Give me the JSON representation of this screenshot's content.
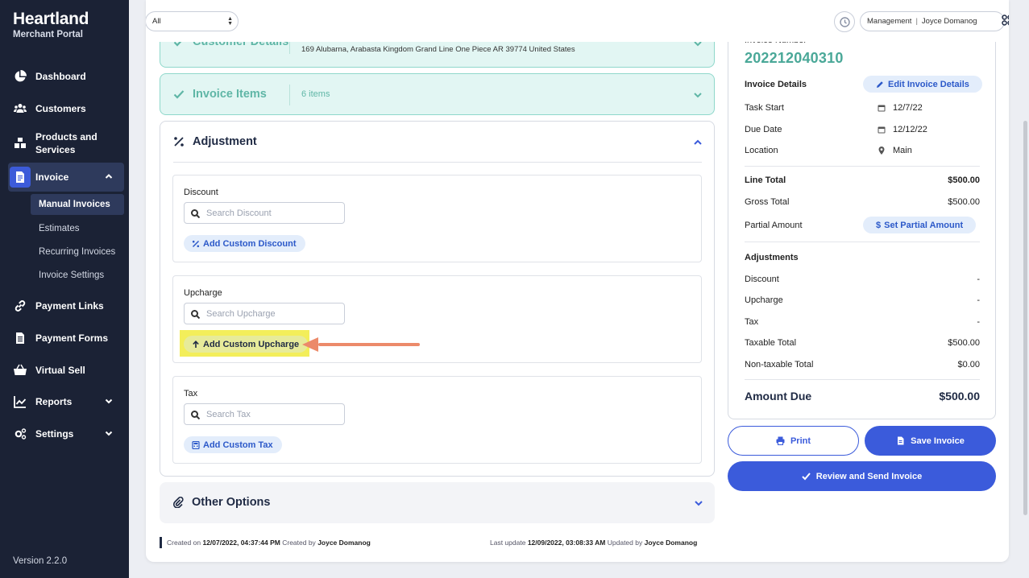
{
  "brand": {
    "name": "Heartland",
    "subtitle": "Merchant Portal"
  },
  "sidebar": {
    "items": [
      {
        "label": "Dashboard",
        "icon": "pie-chart-icon"
      },
      {
        "label": "Customers",
        "icon": "users-icon"
      },
      {
        "label": "Products and Services",
        "icon": "boxes-icon"
      },
      {
        "label": "Invoice",
        "icon": "invoice-icon",
        "active": true,
        "expanded": true
      },
      {
        "label": "Payment Links",
        "icon": "link-icon"
      },
      {
        "label": "Payment Forms",
        "icon": "form-icon"
      },
      {
        "label": "Virtual Sell",
        "icon": "basket-icon"
      },
      {
        "label": "Reports",
        "icon": "chart-icon",
        "has_chevron": true
      },
      {
        "label": "Settings",
        "icon": "gear-icon",
        "has_chevron": true
      }
    ],
    "invoice_subitems": [
      {
        "label": "Manual Invoices",
        "active": true
      },
      {
        "label": "Estimates"
      },
      {
        "label": "Recurring Invoices"
      },
      {
        "label": "Invoice Settings"
      }
    ],
    "version": "Version 2.2.0"
  },
  "topbar": {
    "filter_value": "All",
    "role": "Management",
    "separator": "|",
    "user": "Joyce Domanog"
  },
  "customer_details": {
    "title": "Customer Details",
    "address": "169 Alubarna, Arabasta Kingdom Grand Line One Piece AR 39774 United States"
  },
  "invoice_items": {
    "title": "Invoice Items",
    "count": "6 items"
  },
  "adjustment": {
    "title": "Adjustment",
    "discount": {
      "label": "Discount",
      "placeholder": "Search Discount",
      "button": "Add Custom Discount"
    },
    "upcharge": {
      "label": "Upcharge",
      "placeholder": "Search Upcharge",
      "button": "Add Custom Upcharge"
    },
    "tax": {
      "label": "Tax",
      "placeholder": "Search Tax",
      "button": "Add Custom Tax"
    }
  },
  "other_options": {
    "title": "Other Options"
  },
  "meta": {
    "created_prefix": "Created on",
    "created_on": "12/07/2022, 04:37:44 PM",
    "created_by_prefix": "Created by",
    "created_by": "Joyce Domanog",
    "updated_prefix": "Last update",
    "updated_on": "12/09/2022, 03:08:33 AM",
    "updated_by_prefix": "Updated by",
    "updated_by": "Joyce Domanog"
  },
  "summary": {
    "invoice_number_label": "Invoice Number",
    "invoice_number": "202212040310",
    "details_label": "Invoice Details",
    "edit_button": "Edit Invoice Details",
    "task_start_label": "Task Start",
    "task_start": "12/7/22",
    "due_date_label": "Due Date",
    "due_date": "12/12/22",
    "location_label": "Location",
    "location": "Main",
    "line_total_label": "Line Total",
    "line_total": "$500.00",
    "gross_total_label": "Gross Total",
    "gross_total": "$500.00",
    "partial_amount_label": "Partial Amount",
    "partial_button": "Set Partial Amount",
    "adjustments_label": "Adjustments",
    "discount_label": "Discount",
    "discount": "-",
    "upcharge_label": "Upcharge",
    "upcharge": "-",
    "tax_label": "Tax",
    "tax": "-",
    "taxable_total_label": "Taxable Total",
    "taxable_total": "$500.00",
    "non_taxable_total_label": "Non-taxable Total",
    "non_taxable_total": "$0.00",
    "amount_due_label": "Amount Due",
    "amount_due": "$500.00"
  },
  "actions": {
    "print": "Print",
    "save": "Save Invoice",
    "review_send": "Review and Send Invoice"
  },
  "colors": {
    "sidebar_bg": "#1b2235",
    "accent_blue": "#3b5bdb",
    "teal": "#5fb6a6",
    "highlight": "#f3ee5a",
    "annotation_arrow": "#ec8a6a"
  }
}
